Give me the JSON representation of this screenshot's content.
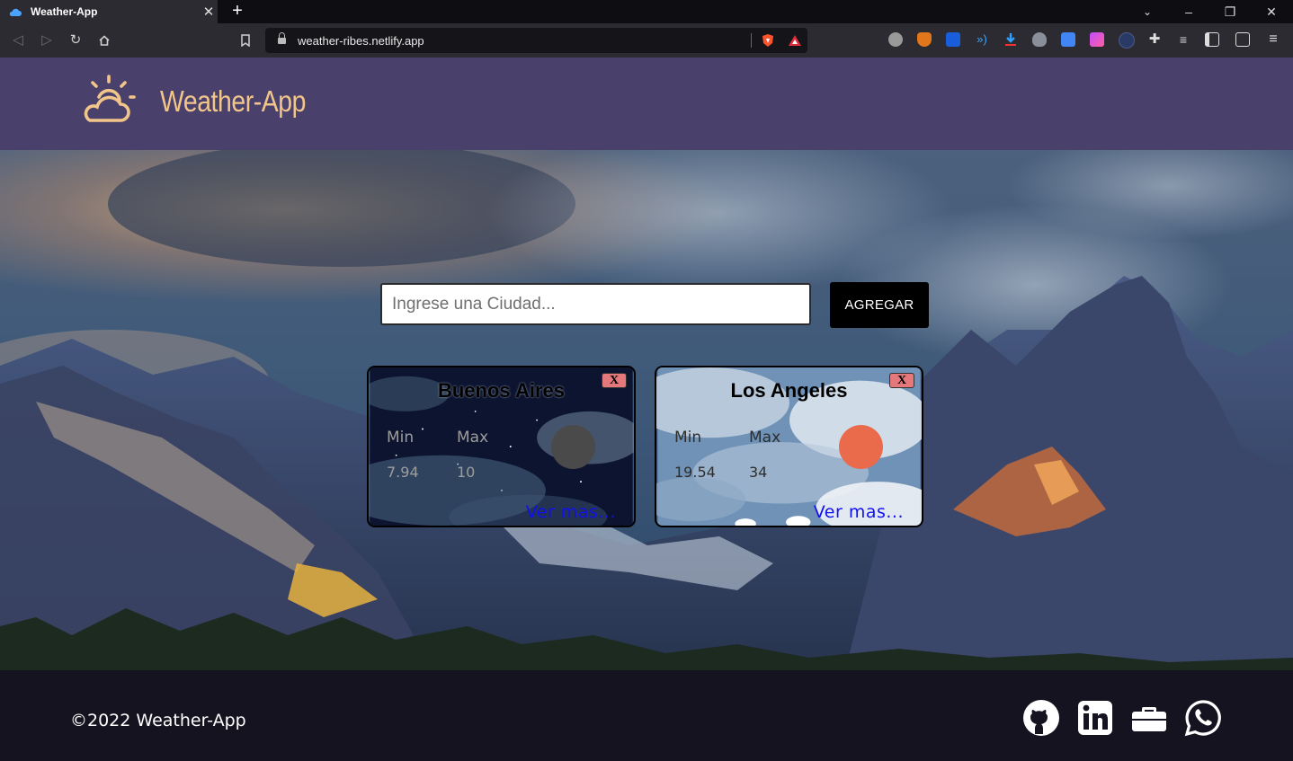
{
  "browser": {
    "tab_title": "Weather-App",
    "tab_close": "✕",
    "new_tab": "+",
    "url": "weather-ribes.netlify.app",
    "window_controls": {
      "minimize": "–",
      "maximize": "❐",
      "close": "✕"
    },
    "nav_icons": [
      "back-icon",
      "forward-icon",
      "reload-icon",
      "home-icon",
      "bookmark-icon"
    ],
    "extension_icons": [
      "brave-shield-icon",
      "brave-rewards-icon",
      "k-extension-icon",
      "metamask-icon",
      "bitwarden-icon",
      "wifi-icon",
      "download-icon",
      "cat-icon",
      "translate-icon",
      "color-picker-icon",
      "avatar-icon",
      "extensions-puzzle-icon",
      "playlist-icon",
      "sidebar-icon",
      "wallet-icon",
      "menu-icon"
    ]
  },
  "header": {
    "brand": "Weather-App",
    "logo_icon": "sun-cloud-icon",
    "brand_color": "#f2c58a",
    "background": "#49406b"
  },
  "search": {
    "placeholder": "Ingrese una Ciudad...",
    "value": "",
    "button_label": "AGREGAR"
  },
  "cards": [
    {
      "city": "Buenos Aires",
      "close_label": "X",
      "min_label": "Min",
      "max_label": "Max",
      "min": "7.94",
      "max": "10",
      "more_label": "Ver mas...",
      "theme": "night",
      "orb_color": "#4a4a4a"
    },
    {
      "city": "Los Angeles",
      "close_label": "X",
      "min_label": "Min",
      "max_label": "Max",
      "min": "19.54",
      "max": "34",
      "more_label": "Ver mas...",
      "theme": "day",
      "orb_color": "#ea6b4c"
    }
  ],
  "footer": {
    "copyright": "©2022 Weather-App",
    "social_icons": [
      "github-icon",
      "linkedin-icon",
      "briefcase-icon",
      "whatsapp-icon"
    ]
  }
}
